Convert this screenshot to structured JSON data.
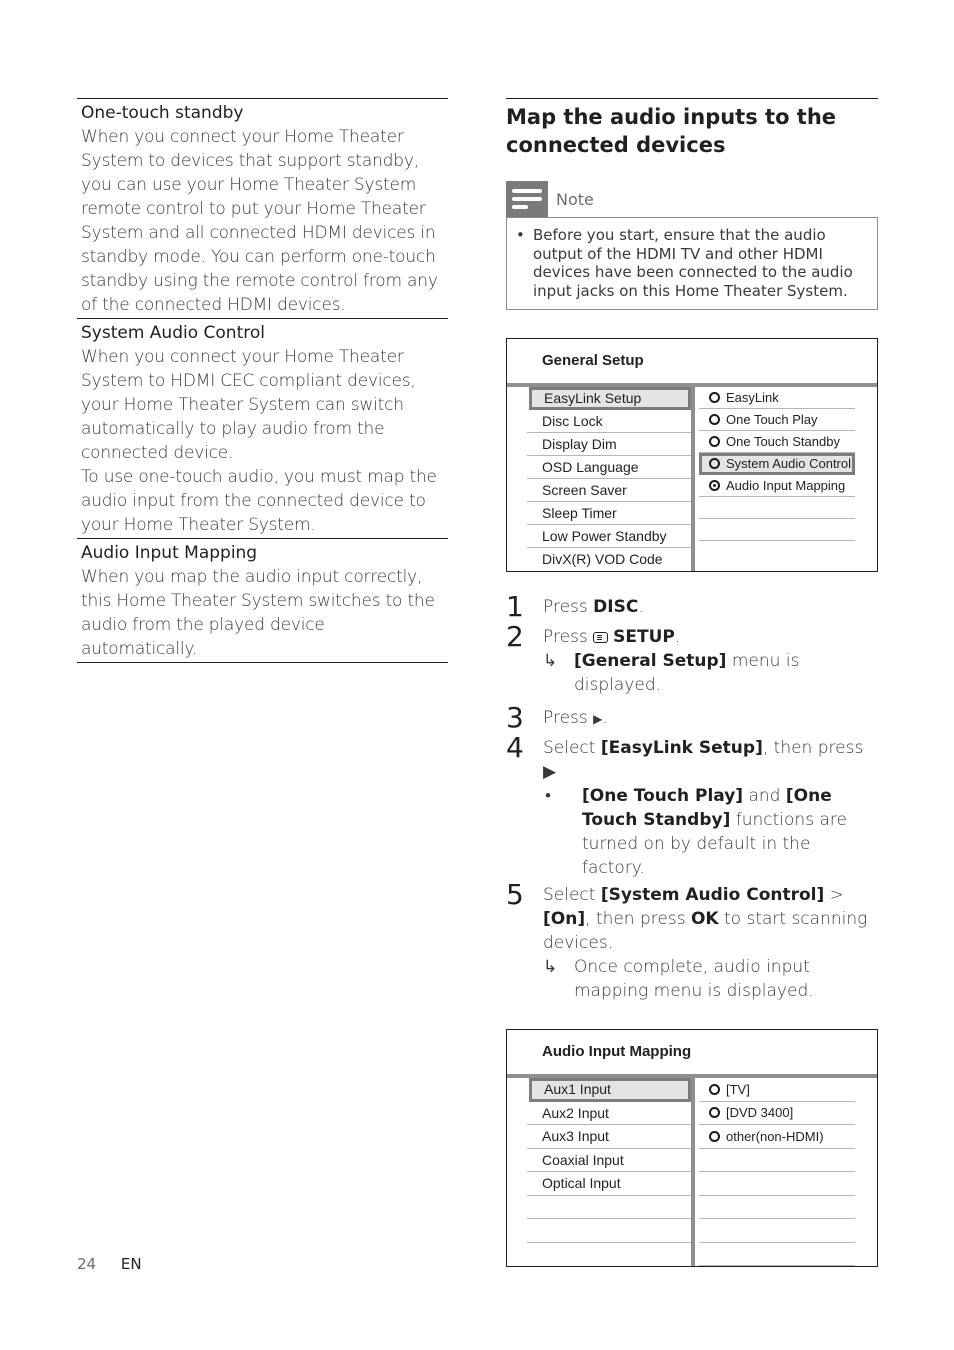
{
  "left_column": {
    "terms": [
      {
        "title": "One-touch standby",
        "paragraphs": [
          "When you connect your Home Theater System to devices that support standby, you can use your Home Theater System remote control to put your Home Theater System and all connected HDMI devices in standby mode. You can perform one-touch standby using the remote control from any of the connected HDMI devices."
        ]
      },
      {
        "title": "System Audio Control",
        "paragraphs": [
          "When you connect your Home Theater System to HDMI CEC compliant devices, your Home Theater System can switch automatically to play audio from the connected device.",
          "To use one-touch audio, you must map the audio input from the connected device to your Home Theater System."
        ]
      },
      {
        "title": "Audio Input Mapping",
        "paragraphs": [
          "When you map the audio input correctly, this Home Theater System switches to the audio from the played device automatically."
        ]
      }
    ]
  },
  "right_column": {
    "section_title": "Map the audio inputs to the connected devices",
    "note": {
      "label": "Note",
      "bullet": "•",
      "text": "Before you start, ensure that the audio output of the HDMI TV and other HDMI devices have been connected to the audio input jacks on this Home Theater System."
    },
    "general_setup_menu": {
      "title": "General Setup",
      "left_items": [
        "EasyLink Setup",
        "Disc Lock",
        "Display Dim",
        "OSD Language",
        "Screen Saver",
        "Sleep Timer",
        "Low Power Standby",
        "DivX(R) VOD Code"
      ],
      "left_selected": "EasyLink Setup",
      "right_items": [
        "EasyLink",
        "One Touch Play",
        "One Touch Standby",
        "System Audio Control",
        "Audio Input Mapping"
      ],
      "right_selected": "System Audio Control"
    },
    "steps": [
      {
        "num": "1",
        "pre": "Press ",
        "bold": "DISC",
        "post": "."
      },
      {
        "num": "2",
        "pre": "Press ",
        "icon": "setup-icon",
        "bold": "SETUP",
        "post": ".",
        "result_arrow": "↳",
        "result_bold": "[General Setup]",
        "result_text": " menu is displayed."
      },
      {
        "num": "3",
        "pre": "Press ",
        "symbol": "▶",
        "post": "."
      },
      {
        "num": "4",
        "pre": "Select ",
        "bold": "[EasyLink Setup]",
        "post": ", then press ▶",
        "bullet": "•",
        "bullet_bold1": "[One Touch Play]",
        "bullet_mid": " and ",
        "bullet_bold2": "[One Touch Standby]",
        "bullet_post": " functions are turned on by default in the factory."
      },
      {
        "num": "5",
        "pre": "Select ",
        "bold": "[System Audio Control]",
        "mid": " > ",
        "bold2": "[On]",
        "mid2": ", then press ",
        "bold3": "OK",
        "post": " to start scanning devices.",
        "result_arrow": "↳",
        "result_text": "Once complete, audio input mapping menu is displayed."
      }
    ],
    "audio_input_menu": {
      "title": "Audio Input Mapping",
      "left_items": [
        "Aux1 Input",
        "Aux2 Input",
        "Aux3 Input",
        "Coaxial Input",
        "Optical Input",
        "",
        "",
        ""
      ],
      "left_selected": "Aux1 Input",
      "right_items": [
        "[TV]",
        "[DVD 3400]",
        "other(non-HDMI)",
        "",
        "",
        "",
        "",
        ""
      ]
    }
  },
  "footer": {
    "page_number": "24",
    "language": "EN"
  }
}
